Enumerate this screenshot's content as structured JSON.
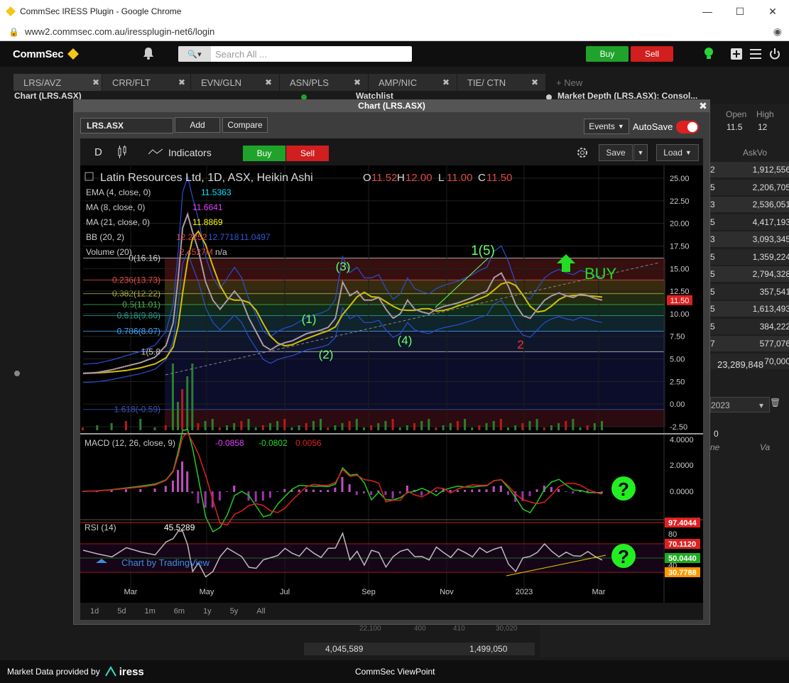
{
  "browser": {
    "title": "CommSec IRESS Plugin - Google Chrome",
    "url": "www2.commsec.com.au/iressplugin-net6/login"
  },
  "topbar": {
    "logo": "CommSec",
    "search_placeholder": "Search All ...",
    "buy_label": "Buy",
    "sell_label": "Sell"
  },
  "tabs": [
    {
      "label": "LRS/AVZ"
    },
    {
      "label": "CRR/FLT"
    },
    {
      "label": "EVN/GLN"
    },
    {
      "label": "ASN/PLS"
    },
    {
      "label": "AMP/NIC"
    },
    {
      "label": "TIE/ CTN"
    },
    {
      "label": "New"
    }
  ],
  "panels": {
    "chart_header": "Chart (LRS.ASX)",
    "watchlist_header": "Watchlist",
    "depth_header": "Market Depth (LRS.ASX): Consol...",
    "open_label": "Open",
    "high_label": "High",
    "open_value": "11.5",
    "high_value": "12",
    "askvol_label": "AskVo",
    "ask_digits": [
      "2",
      "5",
      "3",
      "5",
      "3",
      "5",
      "5",
      "5",
      "5",
      "5",
      "7"
    ],
    "ask_volumes": [
      "1,912,556",
      "2,206,705",
      "2,536,051",
      "4,417,193",
      "3,093,345",
      "1,359,224",
      "2,794,328",
      "357,541",
      "1,613,493",
      "384,222",
      "577,076",
      "70,000"
    ],
    "depth_total": "23,289,848",
    "year_select": "2023",
    "zero_value": "0",
    "col_ne": "ne",
    "col_va": "Va",
    "bottom_left_total": "4,045,589",
    "bottom_right_total": "1,499,050",
    "bottom_partial": [
      "22,100",
      "400",
      "410",
      "30,020"
    ]
  },
  "modal": {
    "title": "Chart (LRS.ASX)",
    "symbol_value": "LRS.ASX",
    "add_label": "Add",
    "compare_label": "Compare",
    "events_label": "Events",
    "autosave_label": "AutoSave",
    "toolbar": {
      "interval": "D",
      "indicators_label": "Indicators",
      "buy_label": "Buy",
      "sell_label": "Sell",
      "save_label": "Save",
      "load_label": "Load"
    },
    "timeframes": [
      "1d",
      "5d",
      "1m",
      "6m",
      "1y",
      "5y",
      "All"
    ]
  },
  "footer": {
    "left": "Market Data provided by",
    "brand": "iress",
    "center": "CommSec ViewPoint"
  },
  "chart_data": {
    "type": "line",
    "title": "Latin Resources Ltd, 1D, ASX, Heikin Ashi",
    "ohlc": {
      "O": "11.52",
      "H": "12.00",
      "L": "11.00",
      "C": "11.50"
    },
    "last_price": "11.50",
    "indicators": [
      {
        "name": "EMA (4, close, 0)",
        "value": "11.5363",
        "color": "#00e5ff"
      },
      {
        "name": "MA (8, close, 0)",
        "value": "11.6641",
        "color": "#e040fb"
      },
      {
        "name": "MA (21, close, 0)",
        "value": "11.8869",
        "color": "#ffff00"
      },
      {
        "name": "BB (20, 2)",
        "values": [
          "12.2252",
          "12.7718",
          "11.0497"
        ],
        "color": "#2a5bd7"
      },
      {
        "name": "Volume (20)",
        "values": [
          "2.4527M",
          "n/a"
        ],
        "color": "#e53935"
      }
    ],
    "fib_levels": [
      {
        "label": "0(16.16)",
        "value": 16.16,
        "color": "#cccccc"
      },
      {
        "label": "0.236(13.73)",
        "value": 13.73,
        "color": "#e05050"
      },
      {
        "label": "0.382(12.22)",
        "value": 12.22,
        "color": "#b5b54a"
      },
      {
        "label": "0.5(11.01)",
        "value": 11.01,
        "color": "#4caf50"
      },
      {
        "label": "0.618(9.80)",
        "value": 9.8,
        "color": "#26a69a"
      },
      {
        "label": "0.786(8.07)",
        "value": 8.07,
        "color": "#42a5f5"
      },
      {
        "label": "1(5.8",
        "value": 5.8,
        "color": "#cccccc"
      },
      {
        "label": "1.618(-0.59)",
        "value": -0.59,
        "color": "#3f51b5"
      }
    ],
    "y_ticks": [
      "25.00",
      "22.50",
      "20.00",
      "17.50",
      "15.00",
      "12.50",
      "10.00",
      "7.50",
      "5.00",
      "2.50",
      "0.00",
      "-2.50"
    ],
    "ylim": [
      -2.5,
      25
    ],
    "x_ticks": [
      "Mar",
      "May",
      "Jul",
      "Sep",
      "Nov",
      "2023",
      "Mar"
    ],
    "price_points": [
      [
        0,
        3.4
      ],
      [
        20,
        3.5
      ],
      [
        40,
        3.8
      ],
      [
        60,
        4.2
      ],
      [
        80,
        4.6
      ],
      [
        100,
        5.2
      ],
      [
        115,
        6.5
      ],
      [
        125,
        9.0
      ],
      [
        132,
        14.0
      ],
      [
        138,
        19.5
      ],
      [
        145,
        21.0
      ],
      [
        152,
        19.0
      ],
      [
        160,
        17.0
      ],
      [
        170,
        13.5
      ],
      [
        180,
        11.5
      ],
      [
        190,
        10.5
      ],
      [
        200,
        11.5
      ],
      [
        210,
        12.5
      ],
      [
        220,
        11.5
      ],
      [
        230,
        9.5
      ],
      [
        240,
        8.0
      ],
      [
        250,
        6.5
      ],
      [
        260,
        6.0
      ],
      [
        270,
        6.5
      ],
      [
        280,
        6.8
      ],
      [
        290,
        7.0
      ],
      [
        300,
        7.4
      ],
      [
        310,
        7.8
      ],
      [
        320,
        8.0
      ],
      [
        330,
        8.2
      ],
      [
        340,
        8.5
      ],
      [
        350,
        9.5
      ],
      [
        360,
        13.5
      ],
      [
        370,
        12.0
      ],
      [
        380,
        12.5
      ],
      [
        390,
        11.5
      ],
      [
        400,
        11.5
      ],
      [
        410,
        11.8
      ],
      [
        420,
        10.5
      ],
      [
        430,
        9.5
      ],
      [
        440,
        10.0
      ],
      [
        450,
        11.5
      ],
      [
        460,
        10.5
      ],
      [
        470,
        10.2
      ],
      [
        480,
        10.0
      ],
      [
        490,
        10.5
      ],
      [
        500,
        10.8
      ],
      [
        510,
        11.0
      ],
      [
        520,
        11.2
      ],
      [
        530,
        11.5
      ],
      [
        540,
        11.8
      ],
      [
        550,
        12.2
      ],
      [
        560,
        12.5
      ],
      [
        570,
        14.0
      ],
      [
        580,
        14.5
      ],
      [
        590,
        13.0
      ],
      [
        600,
        11.0
      ],
      [
        610,
        9.8
      ],
      [
        620,
        9.5
      ],
      [
        630,
        10.5
      ],
      [
        640,
        11.5
      ],
      [
        650,
        12.0
      ],
      [
        660,
        12.3
      ],
      [
        670,
        12.0
      ],
      [
        680,
        11.8
      ],
      [
        690,
        12.2
      ],
      [
        700,
        12.0
      ],
      [
        710,
        11.7
      ],
      [
        720,
        11.5
      ]
    ],
    "wave_labels": [
      {
        "label": "(1)",
        "color": "#66ff66"
      },
      {
        "label": "(2)",
        "color": "#66ff66"
      },
      {
        "label": "(3)",
        "color": "#66ff66"
      },
      {
        "label": "(4)",
        "color": "#66ff66"
      },
      {
        "label": "1(5)",
        "color": "#66ff66"
      },
      {
        "label": "2",
        "color": "#ff3030"
      }
    ],
    "buy_annotation": "BUY",
    "macd": {
      "title": "MACD (12, 26, close, 9)",
      "values": [
        "-0.0858",
        "-0.0802",
        "0.0056"
      ],
      "y_ticks": [
        "4.0000",
        "2.0000",
        "0.0000"
      ]
    },
    "rsi": {
      "title": "RSI (14)",
      "value": "45.5289",
      "y_ticks": [
        "97.4044",
        "80",
        "70.1120",
        "50.0440",
        "40",
        "30.7788"
      ]
    },
    "watermark": "Chart by TradingView",
    "question_marks": [
      "?",
      "?"
    ]
  }
}
